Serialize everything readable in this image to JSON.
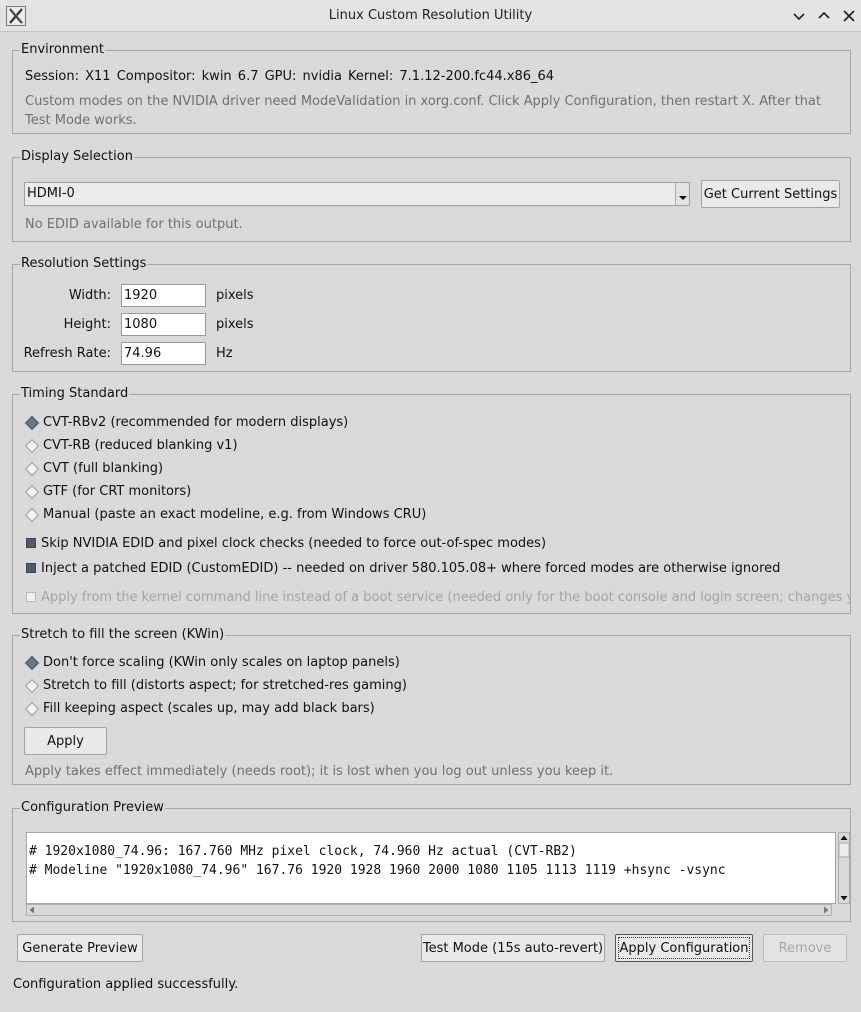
{
  "window": {
    "title": "Linux Custom Resolution Utility",
    "app_icon": "x-logo-icon",
    "controls": [
      "chevron-down-icon",
      "chevron-up-icon",
      "close-icon"
    ]
  },
  "environment": {
    "legend": "Environment",
    "session_info": "Session: X11   Compositor: kwin 6.7   GPU: nvidia   Kernel: 7.1.12-200.fc44.x86_64",
    "note_line1": "Custom modes on the NVIDIA driver need ModeValidation in xorg.conf. Click Apply Configuration, then restart X. After that",
    "note_line2": "Test Mode works."
  },
  "display": {
    "legend": "Display Selection",
    "selected_output": "HDMI-0",
    "get_settings_label": "Get Current Settings",
    "edid_status": "No EDID available for this output."
  },
  "resolution": {
    "legend": "Resolution Settings",
    "width_label": "Width:",
    "width_value": "1920",
    "width_unit": "pixels",
    "height_label": "Height:",
    "height_value": "1080",
    "height_unit": "pixels",
    "refresh_label": "Refresh Rate:",
    "refresh_value": "74.96",
    "refresh_unit": "Hz"
  },
  "timing": {
    "legend": "Timing Standard",
    "options": [
      {
        "label": "CVT-RBv2 (recommended for modern displays)",
        "selected": true
      },
      {
        "label": "CVT-RB (reduced blanking v1)",
        "selected": false
      },
      {
        "label": "CVT (full blanking)",
        "selected": false
      },
      {
        "label": "GTF (for CRT monitors)",
        "selected": false
      },
      {
        "label": "Manual (paste an exact modeline, e.g. from Windows CRU)",
        "selected": false
      }
    ],
    "skip_checks_label": "Skip NVIDIA EDID and pixel clock checks (needed to force out-of-spec modes)",
    "skip_checks_checked": true,
    "inject_edid_label": "Inject a patched EDID (CustomEDID) -- needed on driver 580.105.08+ where forced modes are otherwise ignored",
    "inject_edid_checked": true,
    "kernel_cmdline_label": "Apply from the kernel command line instead of a boot service (needed only for the boot console and login screen; changes your b",
    "kernel_cmdline_checked": false,
    "kernel_cmdline_enabled": false
  },
  "stretch": {
    "legend": "Stretch to fill the screen (KWin)",
    "options": [
      {
        "label": "Don't force scaling (KWin only scales on laptop panels)",
        "selected": true
      },
      {
        "label": "Stretch to fill (distorts aspect; for stretched-res gaming)",
        "selected": false
      },
      {
        "label": "Fill keeping aspect (scales up, may add black bars)",
        "selected": false
      }
    ],
    "apply_label": "Apply",
    "note": "Apply takes effect immediately (needs root); it is lost when you log out unless you keep it."
  },
  "preview": {
    "legend": "Configuration Preview",
    "lines": [
      "# 1920x1080_74.96: 167.760 MHz pixel clock, 74.960 Hz actual (CVT-RB2)",
      "# Modeline \"1920x1080_74.96\" 167.76 1920 1928 1960 2000 1080 1105 1113 1119 +hsync -vsync"
    ]
  },
  "actions": {
    "generate_label": "Generate Preview",
    "test_label": "Test Mode (15s auto-revert)",
    "apply_label": "Apply Configuration",
    "remove_label": "Remove"
  },
  "status": "Configuration applied successfully."
}
